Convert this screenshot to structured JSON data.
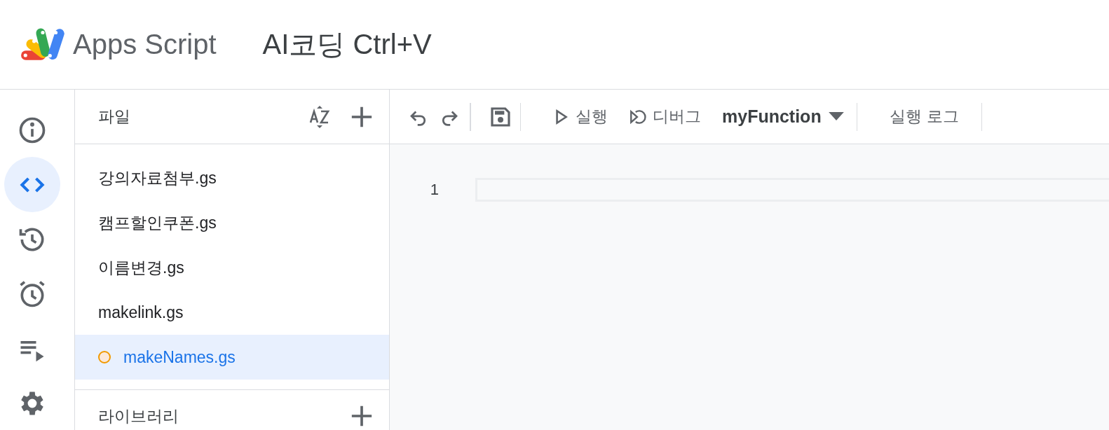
{
  "header": {
    "product": "Apps Script",
    "project_title": "AI코딩 Ctrl+V"
  },
  "rail": [
    {
      "selected": false
    },
    {
      "selected": true
    },
    {
      "selected": false
    },
    {
      "selected": false
    },
    {
      "selected": false
    },
    {
      "selected": false
    }
  ],
  "files_panel": {
    "title": "파일",
    "files": [
      {
        "name": "강의자료첨부.gs",
        "selected": false,
        "modified": false
      },
      {
        "name": "캠프할인쿠폰.gs",
        "selected": false,
        "modified": false
      },
      {
        "name": "이름변경.gs",
        "selected": false,
        "modified": false
      },
      {
        "name": "makelink.gs",
        "selected": false,
        "modified": false
      },
      {
        "name": "makeNames.gs",
        "selected": true,
        "modified": true
      }
    ],
    "libraries_title": "라이브러리"
  },
  "toolbar": {
    "run": "실행",
    "debug": "디버그",
    "function": "myFunction",
    "log": "실행 로그"
  },
  "editor": {
    "line_numbers": [
      "1"
    ]
  }
}
